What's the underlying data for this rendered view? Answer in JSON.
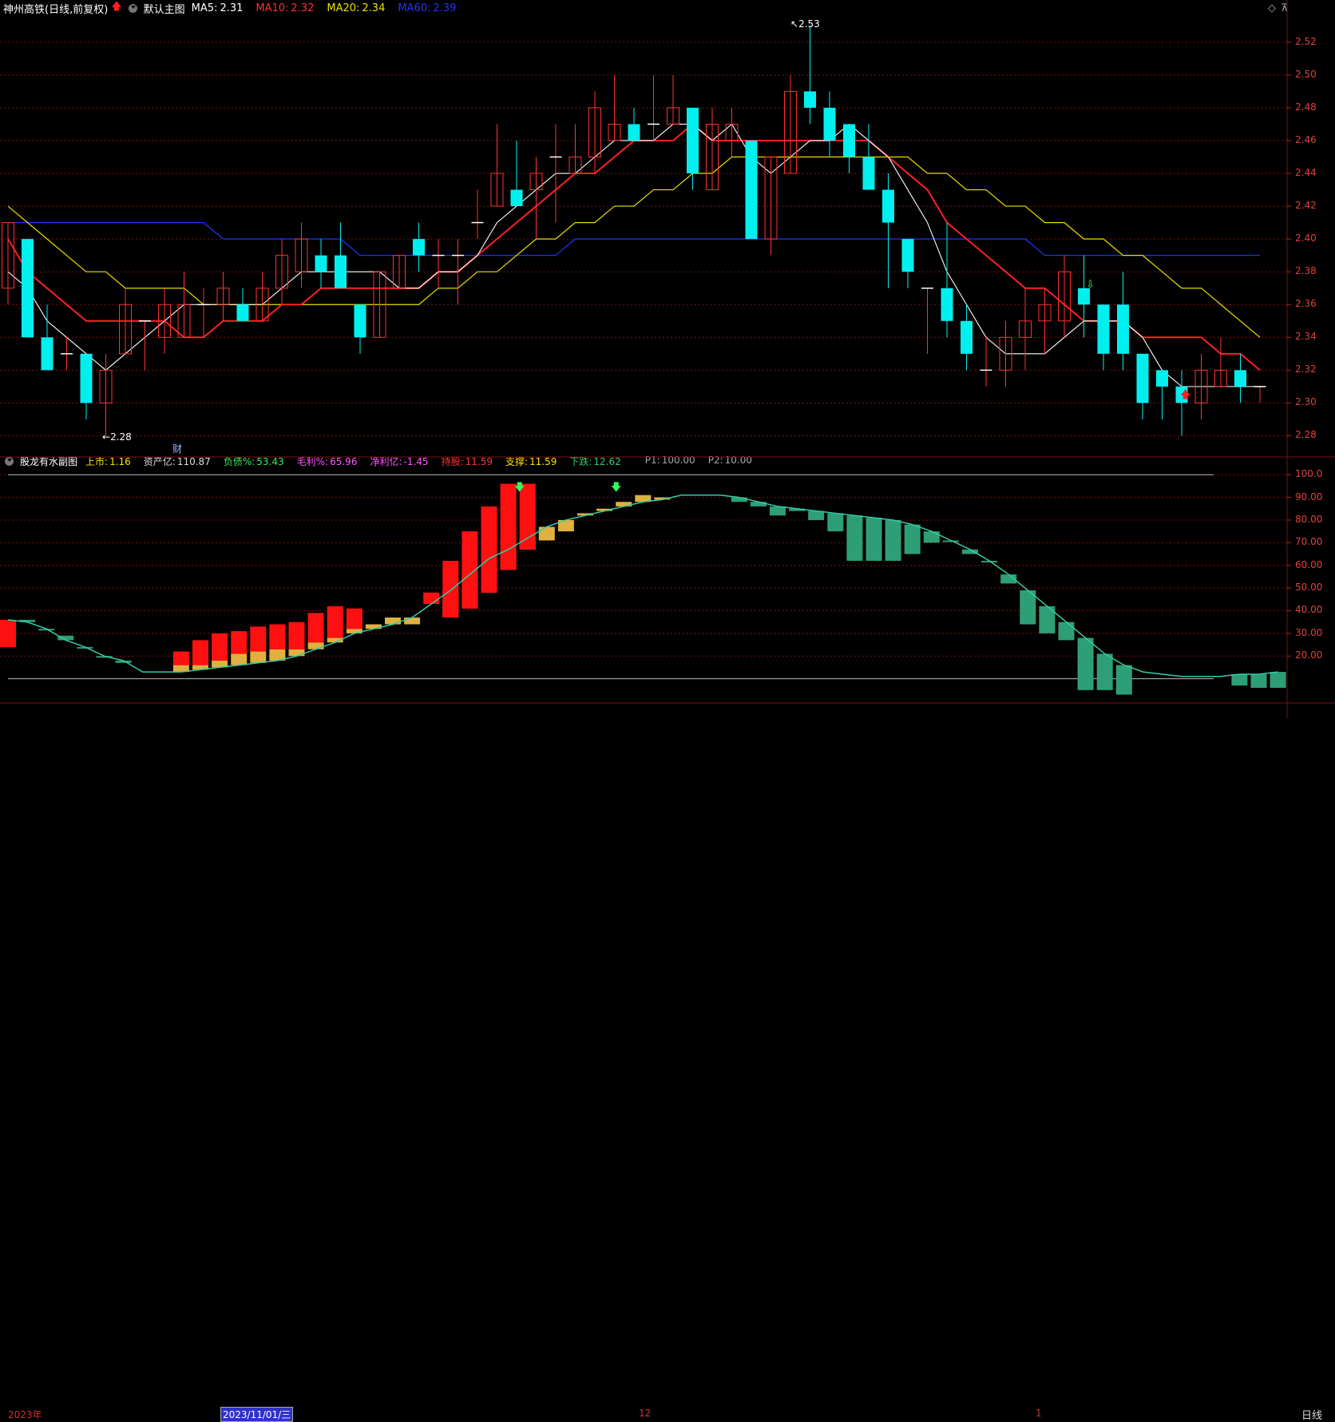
{
  "main_header": {
    "title": "神州高铁(日线,前复权)",
    "template": "默认主图",
    "ma5_label": "MA5:",
    "ma5_value": "2.31",
    "ma10_label": "MA10:",
    "ma10_value": "2.32",
    "ma20_label": "MA20:",
    "ma20_value": "2.34",
    "ma60_label": "MA60:",
    "ma60_value": "2.39"
  },
  "sub_header": {
    "title": "股龙有水副图",
    "items": [
      {
        "label": "上市:",
        "value": "1.16",
        "color": "#ffe000"
      },
      {
        "label": "资产亿:",
        "value": "110.87",
        "color": "#dddddd"
      },
      {
        "label": "负债%:",
        "value": "53.43",
        "color": "#33ee55"
      },
      {
        "label": "毛利%:",
        "value": "65.96",
        "color": "#ff55ff"
      },
      {
        "label": "净利亿:",
        "value": "-1.45",
        "color": "#ff55ff"
      },
      {
        "label": "持股:",
        "value": "11.59",
        "color": "#ff3333"
      },
      {
        "label": "支撑:",
        "value": "11.59",
        "color": "#ffe000"
      },
      {
        "label": "下跌:",
        "value": "12.62",
        "color": "#33cc77"
      },
      {
        "label": "P1:",
        "value": "100.00",
        "color": "#aaaaaa"
      },
      {
        "label": "P2:",
        "value": "10.00",
        "color": "#aaaaaa"
      }
    ]
  },
  "price_axis": [
    "2.52",
    "2.50",
    "2.48",
    "2.46",
    "2.44",
    "2.42",
    "2.40",
    "2.38",
    "2.36",
    "2.34",
    "2.32",
    "2.30",
    "2.28"
  ],
  "sub_axis": [
    "100.0",
    "90.00",
    "80.00",
    "70.00",
    "60.00",
    "50.00",
    "40.00",
    "30.00",
    "20.00"
  ],
  "annotations": {
    "high": "2.53",
    "low": "2.28",
    "fin_badge": "财"
  },
  "dates": {
    "year": "2023年",
    "cursor": "2023/11/01/三",
    "m12": "12",
    "m1": "1"
  },
  "period": "日线",
  "colors": {
    "up": "#ff3232",
    "down": "#00f0f0",
    "ma5": "#ffffff",
    "ma10": "#ff2020",
    "ma20": "#e8e000",
    "ma60": "#2233ff",
    "grid": "#7a1010"
  },
  "chart_data": [
    {
      "type": "candlestick",
      "title": "神州高铁(日线,前复权)",
      "ylim": [
        2.27,
        2.535
      ],
      "candles": [
        {
          "o": 2.37,
          "h": 2.41,
          "l": 2.36,
          "c": 2.41
        },
        {
          "o": 2.4,
          "h": 2.4,
          "l": 2.34,
          "c": 2.34
        },
        {
          "o": 2.34,
          "h": 2.36,
          "l": 2.32,
          "c": 2.32
        },
        {
          "o": 2.33,
          "h": 2.34,
          "l": 2.32,
          "c": 2.33
        },
        {
          "o": 2.33,
          "h": 2.33,
          "l": 2.29,
          "c": 2.3
        },
        {
          "o": 2.3,
          "h": 2.33,
          "l": 2.28,
          "c": 2.32
        },
        {
          "o": 2.33,
          "h": 2.37,
          "l": 2.33,
          "c": 2.36
        },
        {
          "o": 2.35,
          "h": 2.35,
          "l": 2.32,
          "c": 2.35
        },
        {
          "o": 2.34,
          "h": 2.37,
          "l": 2.33,
          "c": 2.36
        },
        {
          "o": 2.34,
          "h": 2.38,
          "l": 2.34,
          "c": 2.36
        },
        {
          "o": 2.36,
          "h": 2.37,
          "l": 2.34,
          "c": 2.36
        },
        {
          "o": 2.36,
          "h": 2.38,
          "l": 2.35,
          "c": 2.37
        },
        {
          "o": 2.36,
          "h": 2.37,
          "l": 2.35,
          "c": 2.35
        },
        {
          "o": 2.35,
          "h": 2.38,
          "l": 2.35,
          "c": 2.37
        },
        {
          "o": 2.37,
          "h": 2.4,
          "l": 2.36,
          "c": 2.39
        },
        {
          "o": 2.38,
          "h": 2.41,
          "l": 2.37,
          "c": 2.4
        },
        {
          "o": 2.39,
          "h": 2.4,
          "l": 2.37,
          "c": 2.38
        },
        {
          "o": 2.39,
          "h": 2.41,
          "l": 2.37,
          "c": 2.37
        },
        {
          "o": 2.36,
          "h": 2.36,
          "l": 2.33,
          "c": 2.34
        },
        {
          "o": 2.34,
          "h": 2.38,
          "l": 2.34,
          "c": 2.38
        },
        {
          "o": 2.37,
          "h": 2.39,
          "l": 2.37,
          "c": 2.39
        },
        {
          "o": 2.4,
          "h": 2.41,
          "l": 2.38,
          "c": 2.39
        },
        {
          "o": 2.39,
          "h": 2.4,
          "l": 2.37,
          "c": 2.39
        },
        {
          "o": 2.39,
          "h": 2.4,
          "l": 2.36,
          "c": 2.39
        },
        {
          "o": 2.41,
          "h": 2.43,
          "l": 2.4,
          "c": 2.41
        },
        {
          "o": 2.42,
          "h": 2.47,
          "l": 2.42,
          "c": 2.44
        },
        {
          "o": 2.43,
          "h": 2.46,
          "l": 2.42,
          "c": 2.42
        },
        {
          "o": 2.43,
          "h": 2.45,
          "l": 2.4,
          "c": 2.44
        },
        {
          "o": 2.45,
          "h": 2.47,
          "l": 2.41,
          "c": 2.45
        },
        {
          "o": 2.44,
          "h": 2.47,
          "l": 2.44,
          "c": 2.45
        },
        {
          "o": 2.45,
          "h": 2.49,
          "l": 2.44,
          "c": 2.48
        },
        {
          "o": 2.46,
          "h": 2.5,
          "l": 2.46,
          "c": 2.47
        },
        {
          "o": 2.47,
          "h": 2.48,
          "l": 2.46,
          "c": 2.46
        },
        {
          "o": 2.47,
          "h": 2.5,
          "l": 2.46,
          "c": 2.47
        },
        {
          "o": 2.47,
          "h": 2.5,
          "l": 2.47,
          "c": 2.48
        },
        {
          "o": 2.48,
          "h": 2.48,
          "l": 2.43,
          "c": 2.44
        },
        {
          "o": 2.43,
          "h": 2.48,
          "l": 2.43,
          "c": 2.47
        },
        {
          "o": 2.46,
          "h": 2.48,
          "l": 2.45,
          "c": 2.47
        },
        {
          "o": 2.46,
          "h": 2.46,
          "l": 2.4,
          "c": 2.4
        },
        {
          "o": 2.4,
          "h": 2.45,
          "l": 2.39,
          "c": 2.45
        },
        {
          "o": 2.44,
          "h": 2.5,
          "l": 2.44,
          "c": 2.49
        },
        {
          "o": 2.49,
          "h": 2.53,
          "l": 2.47,
          "c": 2.48
        },
        {
          "o": 2.48,
          "h": 2.49,
          "l": 2.45,
          "c": 2.46
        },
        {
          "o": 2.47,
          "h": 2.47,
          "l": 2.44,
          "c": 2.45
        },
        {
          "o": 2.45,
          "h": 2.47,
          "l": 2.43,
          "c": 2.43
        },
        {
          "o": 2.43,
          "h": 2.44,
          "l": 2.37,
          "c": 2.41
        },
        {
          "o": 2.4,
          "h": 2.4,
          "l": 2.37,
          "c": 2.38
        },
        {
          "o": 2.37,
          "h": 2.37,
          "l": 2.33,
          "c": 2.37
        },
        {
          "o": 2.37,
          "h": 2.41,
          "l": 2.34,
          "c": 2.35
        },
        {
          "o": 2.35,
          "h": 2.36,
          "l": 2.32,
          "c": 2.33
        },
        {
          "o": 2.32,
          "h": 2.34,
          "l": 2.31,
          "c": 2.32
        },
        {
          "o": 2.32,
          "h": 2.35,
          "l": 2.31,
          "c": 2.34
        },
        {
          "o": 2.34,
          "h": 2.37,
          "l": 2.32,
          "c": 2.35
        },
        {
          "o": 2.35,
          "h": 2.37,
          "l": 2.33,
          "c": 2.36
        },
        {
          "o": 2.35,
          "h": 2.39,
          "l": 2.34,
          "c": 2.38
        },
        {
          "o": 2.37,
          "h": 2.39,
          "l": 2.34,
          "c": 2.36
        },
        {
          "o": 2.36,
          "h": 2.36,
          "l": 2.32,
          "c": 2.33
        },
        {
          "o": 2.36,
          "h": 2.38,
          "l": 2.32,
          "c": 2.33
        },
        {
          "o": 2.33,
          "h": 2.33,
          "l": 2.29,
          "c": 2.3
        },
        {
          "o": 2.32,
          "h": 2.32,
          "l": 2.29,
          "c": 2.31
        },
        {
          "o": 2.31,
          "h": 2.32,
          "l": 2.28,
          "c": 2.3
        },
        {
          "o": 2.3,
          "h": 2.33,
          "l": 2.29,
          "c": 2.32
        },
        {
          "o": 2.31,
          "h": 2.34,
          "l": 2.31,
          "c": 2.32
        },
        {
          "o": 2.32,
          "h": 2.33,
          "l": 2.3,
          "c": 2.31
        },
        {
          "o": 2.31,
          "h": 2.31,
          "l": 2.3,
          "c": 2.31
        }
      ],
      "ma5": [
        2.38,
        2.37,
        2.35,
        2.34,
        2.33,
        2.32,
        2.33,
        2.34,
        2.35,
        2.36,
        2.36,
        2.36,
        2.36,
        2.36,
        2.37,
        2.38,
        2.38,
        2.38,
        2.38,
        2.38,
        2.37,
        2.37,
        2.38,
        2.38,
        2.39,
        2.41,
        2.42,
        2.43,
        2.44,
        2.44,
        2.45,
        2.46,
        2.46,
        2.46,
        2.47,
        2.47,
        2.46,
        2.47,
        2.45,
        2.44,
        2.45,
        2.46,
        2.46,
        2.47,
        2.46,
        2.45,
        2.43,
        2.41,
        2.38,
        2.36,
        2.34,
        2.33,
        2.33,
        2.33,
        2.34,
        2.35,
        2.35,
        2.35,
        2.34,
        2.32,
        2.31,
        2.31,
        2.31,
        2.31,
        2.31
      ],
      "ma10": [
        2.4,
        2.38,
        2.37,
        2.36,
        2.35,
        2.35,
        2.35,
        2.35,
        2.35,
        2.34,
        2.34,
        2.35,
        2.35,
        2.35,
        2.36,
        2.36,
        2.37,
        2.37,
        2.37,
        2.37,
        2.37,
        2.37,
        2.38,
        2.38,
        2.39,
        2.4,
        2.41,
        2.42,
        2.43,
        2.44,
        2.44,
        2.45,
        2.46,
        2.46,
        2.46,
        2.47,
        2.46,
        2.46,
        2.46,
        2.46,
        2.46,
        2.46,
        2.46,
        2.46,
        2.46,
        2.45,
        2.44,
        2.43,
        2.41,
        2.4,
        2.39,
        2.38,
        2.37,
        2.37,
        2.36,
        2.35,
        2.35,
        2.35,
        2.34,
        2.34,
        2.34,
        2.34,
        2.33,
        2.33,
        2.32
      ],
      "ma20": [
        2.42,
        2.41,
        2.4,
        2.39,
        2.38,
        2.38,
        2.37,
        2.37,
        2.37,
        2.37,
        2.36,
        2.36,
        2.36,
        2.36,
        2.36,
        2.36,
        2.36,
        2.36,
        2.36,
        2.36,
        2.36,
        2.36,
        2.37,
        2.37,
        2.38,
        2.38,
        2.39,
        2.4,
        2.4,
        2.41,
        2.41,
        2.42,
        2.42,
        2.43,
        2.43,
        2.44,
        2.44,
        2.45,
        2.45,
        2.45,
        2.45,
        2.45,
        2.45,
        2.45,
        2.45,
        2.45,
        2.45,
        2.44,
        2.44,
        2.43,
        2.43,
        2.42,
        2.42,
        2.41,
        2.41,
        2.4,
        2.4,
        2.39,
        2.39,
        2.38,
        2.37,
        2.37,
        2.36,
        2.35,
        2.34
      ],
      "ma60": [
        2.41,
        2.41,
        2.41,
        2.41,
        2.41,
        2.41,
        2.41,
        2.41,
        2.41,
        2.41,
        2.41,
        2.4,
        2.4,
        2.4,
        2.4,
        2.4,
        2.4,
        2.4,
        2.39,
        2.39,
        2.39,
        2.39,
        2.39,
        2.39,
        2.39,
        2.39,
        2.39,
        2.39,
        2.39,
        2.4,
        2.4,
        2.4,
        2.4,
        2.4,
        2.4,
        2.4,
        2.4,
        2.4,
        2.4,
        2.4,
        2.4,
        2.4,
        2.4,
        2.4,
        2.4,
        2.4,
        2.4,
        2.4,
        2.4,
        2.4,
        2.4,
        2.4,
        2.4,
        2.39,
        2.39,
        2.39,
        2.39,
        2.39,
        2.39,
        2.39,
        2.39,
        2.39,
        2.39,
        2.39,
        2.39
      ]
    },
    {
      "type": "bar",
      "title": "股龙有水副图",
      "ylim": [
        0,
        105
      ],
      "line": [
        36,
        35,
        32,
        27,
        24,
        20,
        18,
        13,
        13,
        13,
        14,
        15,
        16,
        17,
        18,
        20,
        23,
        26,
        30,
        32,
        34,
        37,
        43,
        49,
        56,
        63,
        67,
        72,
        77,
        80,
        82,
        84,
        86,
        88,
        89,
        91,
        91,
        91,
        90,
        88,
        86,
        85,
        84,
        83,
        82,
        81,
        80,
        78,
        75,
        71,
        67,
        62,
        56,
        49,
        42,
        35,
        28,
        21,
        16,
        13,
        12,
        11,
        11,
        11,
        12,
        12,
        13
      ],
      "green": [
        0,
        36,
        32,
        29,
        24,
        20,
        17,
        0,
        0,
        0,
        0,
        0,
        0,
        0,
        0,
        0,
        0,
        0,
        0,
        0,
        0,
        0,
        0,
        0,
        0,
        0,
        0,
        0,
        0,
        0,
        0,
        0,
        0,
        0,
        0,
        0,
        0,
        0,
        88,
        86,
        82,
        84,
        80,
        75,
        62,
        62,
        62,
        65,
        70,
        71,
        65,
        62,
        52,
        34,
        30,
        27,
        5,
        5,
        3,
        0,
        0,
        0,
        0,
        0,
        7,
        6,
        6
      ],
      "gold": [
        0,
        0,
        0,
        0,
        0,
        0,
        0,
        0,
        0,
        16,
        16,
        18,
        21,
        22,
        23,
        23,
        26,
        28,
        32,
        34,
        37,
        34,
        0,
        37,
        41,
        48,
        58,
        67,
        71,
        75,
        83,
        85,
        88,
        91,
        90,
        0,
        0,
        0,
        0,
        0,
        0,
        0,
        0,
        0,
        0,
        0,
        0,
        0,
        0,
        0,
        0,
        0,
        0,
        0,
        0,
        0,
        0,
        0,
        0,
        0,
        0,
        0,
        0,
        0,
        0,
        0,
        0
      ],
      "red": [
        24,
        0,
        0,
        0,
        0,
        0,
        0,
        0,
        0,
        22,
        27,
        30,
        31,
        33,
        34,
        35,
        39,
        42,
        41,
        0,
        0,
        0,
        48,
        62,
        75,
        86,
        96,
        96,
        0,
        0,
        0,
        0,
        0,
        0,
        0,
        0,
        0,
        0,
        0,
        0,
        0,
        0,
        0,
        0,
        0,
        0,
        0,
        0,
        0,
        0,
        0,
        0,
        0,
        0,
        0,
        0,
        0,
        0,
        0,
        0,
        0,
        0,
        0,
        0,
        0,
        0,
        0
      ]
    }
  ]
}
